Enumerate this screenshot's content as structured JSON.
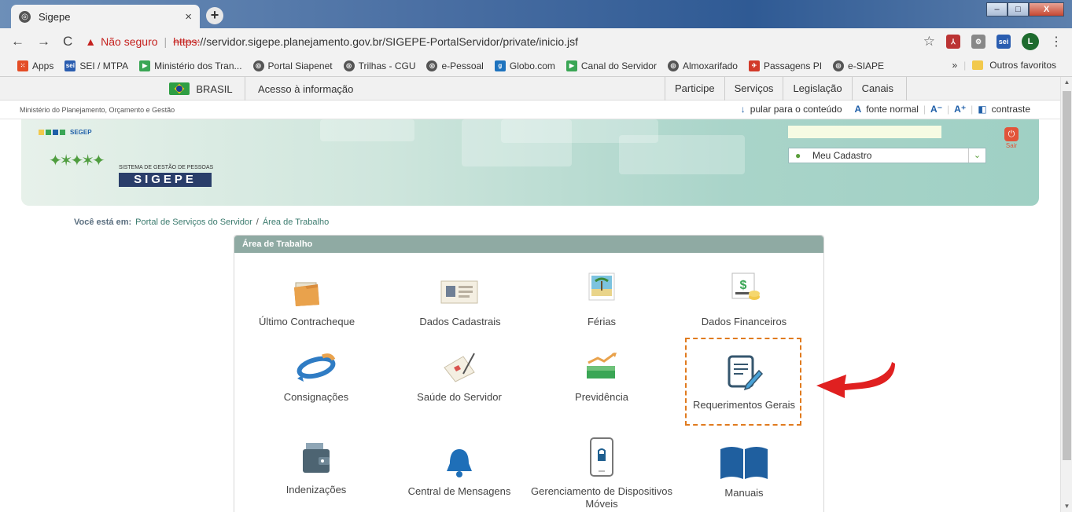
{
  "browser": {
    "tab_title": "Sigepe",
    "tab_close": "×",
    "new_tab": "+",
    "back": "←",
    "forward": "→",
    "reload": "C",
    "security_text": "Não seguro",
    "url_scheme": "https:",
    "url_rest": "//servidor.sigepe.planejamento.gov.br/SIGEPE-PortalServidor/private/inicio.jsf",
    "profile_initial": "L",
    "window_buttons": [
      "–",
      "□",
      "X"
    ]
  },
  "bookmarks": {
    "items": [
      {
        "label": "Apps",
        "color": "#e44d26"
      },
      {
        "label": "SEI / MTPA",
        "color": "#2a5db0",
        "badge": "sei"
      },
      {
        "label": "Ministério dos Tran...",
        "color": "#3aa655"
      },
      {
        "label": "Portal Siapenet",
        "color": "#555555"
      },
      {
        "label": "Trilhas - CGU",
        "color": "#555555"
      },
      {
        "label": "e-Pessoal",
        "color": "#555555"
      },
      {
        "label": "Globo.com",
        "color": "#1e73be",
        "badge": "g"
      },
      {
        "label": "Canal do Servidor",
        "color": "#3aa655"
      },
      {
        "label": "Almoxarifado",
        "color": "#555555"
      },
      {
        "label": "Passagens PI",
        "color": "#d23a2a"
      },
      {
        "label": "e-SIAPE",
        "color": "#555555"
      }
    ],
    "more": "»",
    "other": "Outros favoritos"
  },
  "govbar": {
    "brasil": "BRASIL",
    "acesso": "Acesso à informação",
    "menu": [
      "Participe",
      "Serviços",
      "Legislação",
      "Canais"
    ]
  },
  "ministry": {
    "name": "Ministério do Planejamento, Orçamento e Gestão",
    "skip": "pular para o conteúdo",
    "font_a": "A",
    "font_normal": "fonte normal",
    "font_minus": "A⁻",
    "font_plus": "A⁺",
    "contrast": "contraste"
  },
  "banner": {
    "segep": "SEGEP",
    "system_name": "SISTEMA DE GESTÃO DE PESSOAS",
    "sigepe": "SIGEPE",
    "cadastro": "Meu Cadastro",
    "sair": "Sair"
  },
  "breadcrumb": {
    "prefix": "Você está em:",
    "portal": "Portal de Serviços do Servidor",
    "sep": "/",
    "current": "Área de Trabalho"
  },
  "workarea": {
    "title": "Área de Trabalho",
    "items": [
      "Último Contracheque",
      "Dados Cadastrais",
      "Férias",
      "Dados Financeiros",
      "Consignações",
      "Saúde do Servidor",
      "Previdência",
      "Requerimentos Gerais",
      "Indenizações",
      "Central de Mensagens",
      "Gerenciamento de Dispositivos Móveis",
      "Manuais"
    ]
  }
}
